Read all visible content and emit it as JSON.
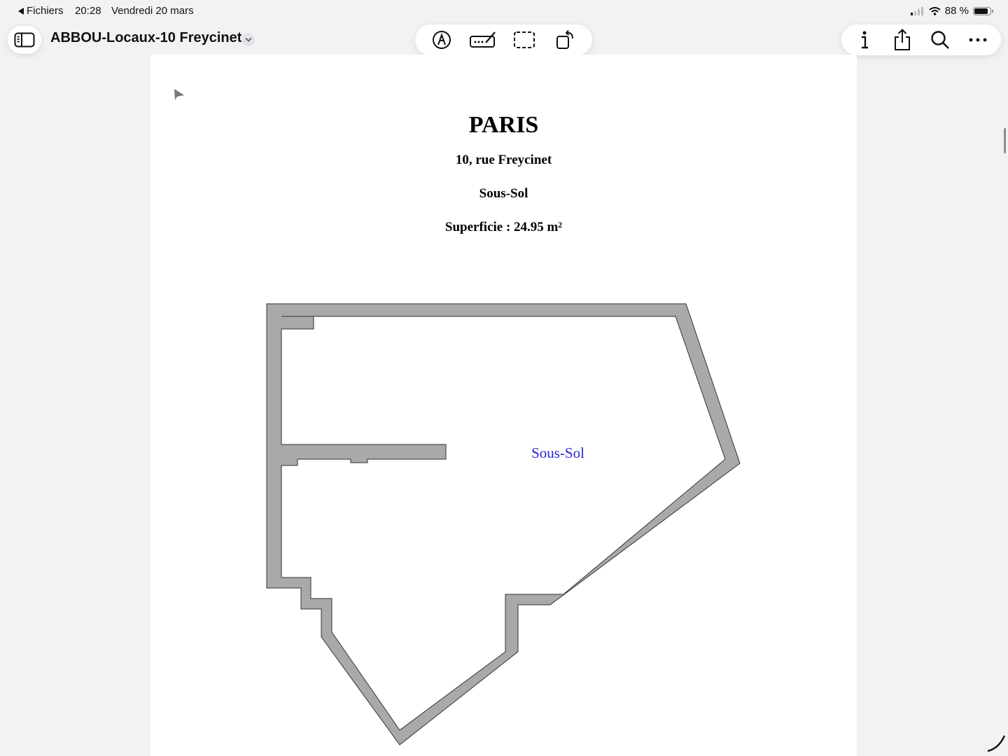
{
  "status_bar": {
    "back_label": "Fichiers",
    "time": "20:28",
    "date": "Vendredi 20 mars",
    "battery_text": "88 %",
    "battery_level": 0.88
  },
  "toolbar": {
    "document_title": "ABBOU-Locaux-10 Freycinet",
    "icons_left": [
      "sidebar-icon"
    ],
    "icons_center": [
      "markup-icon",
      "signature-icon",
      "selection-icon",
      "rotate-icon"
    ],
    "icons_right": [
      "info-icon",
      "share-icon",
      "search-icon",
      "more-icon"
    ]
  },
  "document": {
    "city": "PARIS",
    "address": "10, rue Freycinet",
    "level": "Sous-Sol",
    "area": "Superficie : 24.95 m²",
    "room_label": "Sous-Sol",
    "room_label_color": "#2626d9",
    "wall_color": "#a9a9a9"
  }
}
